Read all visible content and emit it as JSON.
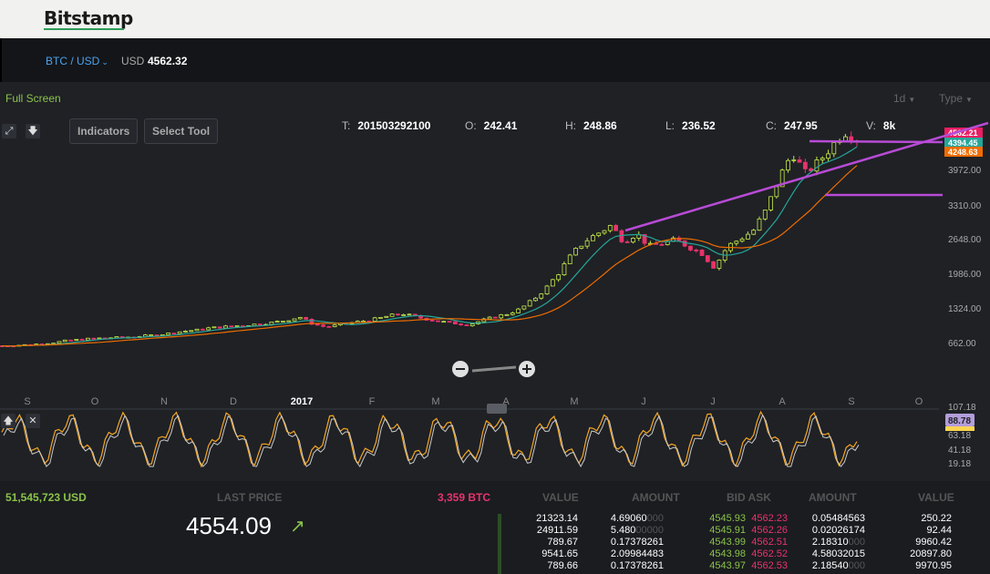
{
  "header": {
    "logo": "Bitstamp"
  },
  "pairbar": {
    "pair": "BTC / USD",
    "currency_label": "USD",
    "price": "4562.32"
  },
  "chart_toolbar": {
    "fullscreen": "Full Screen",
    "period": "1d",
    "type": "Type",
    "indicators": "Indicators",
    "select_tool": "Select Tool"
  },
  "ohlc": {
    "t_label": "T:",
    "t": "201503292100",
    "o_label": "O:",
    "o": "242.41",
    "h_label": "H:",
    "h": "248.86",
    "l_label": "L:",
    "l": "236.52",
    "c_label": "C:",
    "c": "247.95",
    "v_label": "V:",
    "v": "8k"
  },
  "chart_data": {
    "type": "line",
    "price_axis_ticks": [
      "3972.00",
      "3310.00",
      "2648.00",
      "1986.00",
      "1324.00",
      "662.00"
    ],
    "price_tags": [
      {
        "text": "4562.21",
        "color": "#e91e63"
      },
      {
        "text": "4394.45",
        "color": "#26a69a"
      },
      {
        "text": "4248.63",
        "color": "#ef6c00"
      }
    ],
    "x_labels": [
      "S",
      "O",
      "N",
      "D",
      "2017",
      "F",
      "M",
      "A",
      "M",
      "J",
      "J",
      "A",
      "S",
      "O"
    ],
    "close_series": [
      600,
      610,
      620,
      640,
      660,
      700,
      720,
      740,
      750,
      760,
      770,
      790,
      810,
      840,
      880,
      900,
      940,
      960,
      980,
      1000,
      1020,
      1050,
      1090,
      1150,
      1020,
      960,
      1000,
      1040,
      1080,
      1120,
      1180,
      1210,
      1150,
      1100,
      1060,
      1030,
      1000,
      1080,
      1150,
      1210,
      1300,
      1480,
      1700,
      2000,
      2350,
      2600,
      2750,
      2900,
      2600,
      2750,
      2500,
      2560,
      2620,
      2500,
      2380,
      2100,
      2500,
      2650,
      2800,
      3200,
      3800,
      4300,
      3900,
      4100,
      4400,
      4700,
      4562
    ],
    "oscillator_ticks": [
      "107.18",
      "63.18",
      "41.18",
      "19.18"
    ],
    "oscillator_tag": "88.78"
  },
  "bottom": {
    "volume_usd": "51,545,723 USD",
    "last_price_label": "LAST PRICE",
    "volume_btc": "3,359 BTC",
    "last_price": "4554.09",
    "headers": [
      "VALUE",
      "AMOUNT",
      "BID ASK",
      "AMOUNT",
      "VALUE"
    ],
    "rows": [
      {
        "v1": "21323.14",
        "a1": "4.69060",
        "a1d": "000",
        "bid": "4545.93",
        "ask": "4562.23",
        "a2": "0.05484563",
        "a2d": "",
        "v2": "250.22"
      },
      {
        "v1": "24911.59",
        "a1": "5.480",
        "a1d": "00000",
        "bid": "4545.91",
        "ask": "4562.26",
        "a2": "0.02026174",
        "a2d": "",
        "v2": "92.44"
      },
      {
        "v1": "789.67",
        "a1": "0.17378261",
        "a1d": "",
        "bid": "4543.99",
        "ask": "4562.51",
        "a2": "2.18310",
        "a2d": "000",
        "v2": "9960.42"
      },
      {
        "v1": "9541.65",
        "a1": "2.09984483",
        "a1d": "",
        "bid": "4543.98",
        "ask": "4562.52",
        "a2": "4.58032015",
        "a2d": "",
        "v2": "20897.80"
      },
      {
        "v1": "789.66",
        "a1": "0.17378261",
        "a1d": "",
        "bid": "4543.97",
        "ask": "4562.53",
        "a2": "2.18540",
        "a2d": "000",
        "v2": "9970.95"
      }
    ]
  }
}
